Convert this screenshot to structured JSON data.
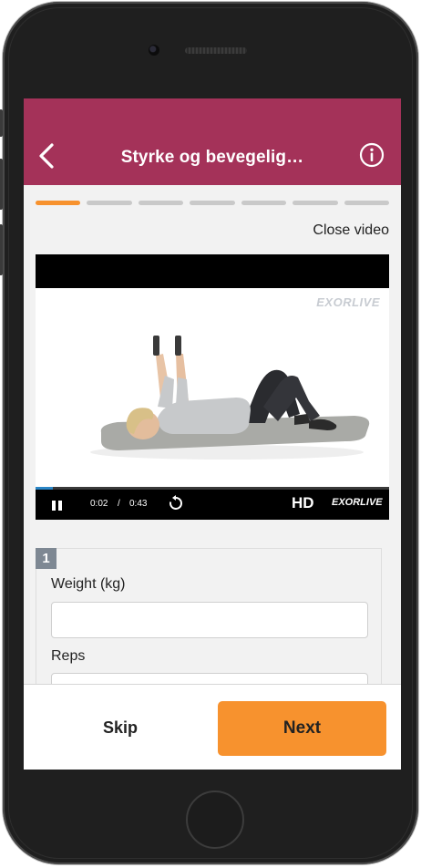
{
  "header": {
    "title": "Styrke og bevegelig…",
    "back_icon": "chevron-left-icon",
    "info_icon": "info-circle-icon"
  },
  "progress": {
    "total_steps": 7,
    "current_step": 1,
    "active_color": "#f7922e",
    "inactive_color": "#c9c9c9"
  },
  "close_video_label": "Close video",
  "video": {
    "watermark": "EXORLIVE",
    "current_time": "0:02",
    "time_separator": "/",
    "duration": "0:43",
    "progress_fraction": 0.05,
    "hd_label": "HD",
    "controls_logo": "EXORLIVE",
    "play_state": "playing"
  },
  "set": {
    "number": "1",
    "weight_label": "Weight (kg)",
    "weight_value": "",
    "reps_label": "Reps",
    "reps_value": ""
  },
  "footer": {
    "skip_label": "Skip",
    "next_label": "Next"
  },
  "colors": {
    "header_bg": "#a43259",
    "accent": "#f7922e",
    "badge_bg": "#7e8893"
  }
}
